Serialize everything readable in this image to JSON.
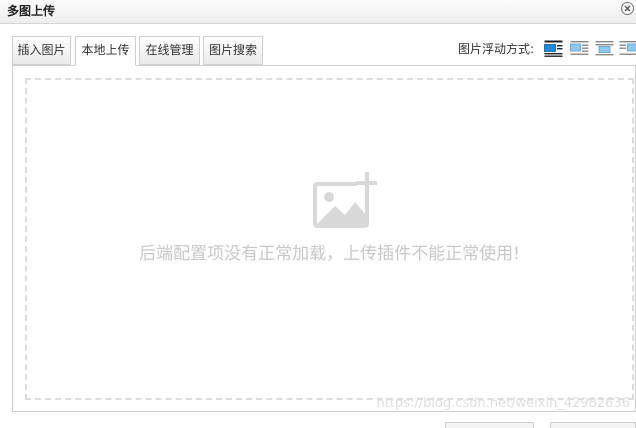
{
  "dialog": {
    "title": "多图上传"
  },
  "tabs": [
    {
      "label": "插入图片",
      "active": false
    },
    {
      "label": "本地上传",
      "active": true
    },
    {
      "label": "在线管理",
      "active": false
    },
    {
      "label": "图片搜索",
      "active": false
    }
  ],
  "float_options": {
    "label": "图片浮动方式:",
    "options": [
      "float-none",
      "float-left",
      "float-center",
      "float-right"
    ],
    "selected": "float-none"
  },
  "upload": {
    "message": "后端配置项没有正常加载，上传插件不能正常使用!",
    "icon": "add-image-icon"
  },
  "watermark": "https://blog.csdn.net/weixin_42982636",
  "colors": {
    "accent_blue": "#1d8bd8",
    "light_blue": "#8fc8ec",
    "placeholder_gray": "#d8d8d8"
  }
}
